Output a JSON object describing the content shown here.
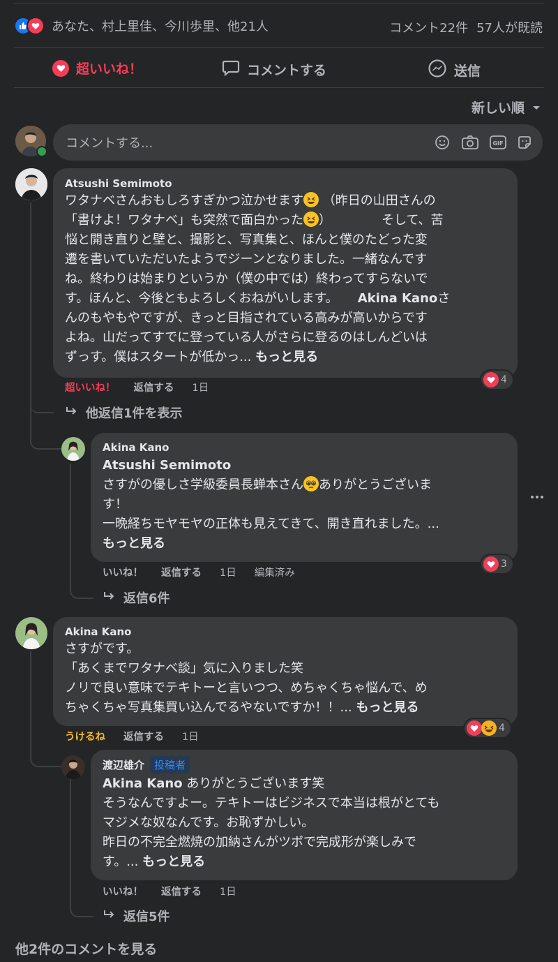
{
  "summary": {
    "reactors_text": "あなた、村上里佳、今川歩里、他21人",
    "comments_count": "コメント22件",
    "seen_count": "57人が既読"
  },
  "actions": {
    "love": "超いいね！",
    "comment": "コメントする",
    "send": "送信"
  },
  "sort": {
    "label": "新しい順"
  },
  "composer": {
    "placeholder": "コメントする..."
  },
  "comments": [
    {
      "author": "Atsushi Semimoto",
      "lines": [
        "ワタナベさんおもしろすぎかつ泣かせます",
        "（昨日の山田さんの",
        "「書けよ！ワタナベ」も突然で面白かった",
        "）",
        "そして、苦",
        "悩と開き直りと壁と、撮影と、写真集と、ほんと僕のたどった変",
        "遷を書いていただいたようでジーンとなりました。一緒なんです",
        "ね。終わりは始まりというか（僕の中では）終わってすらないで",
        "す。ほんと、今後ともよろしくおねがいします。",
        "Akina Kano",
        "さ",
        "んのもやもやですが、きっと目指されている高みが高いからです",
        "よね。山だってすでに登っている人がさらに登るのはしんどいは",
        "ずっす。僕はスタートが低かっ...",
        "もっと見る"
      ],
      "reaction_label": "超いいね！",
      "reply_label": "返信する",
      "time": "1日",
      "reaction_count": "4",
      "more_replies": "他返信1件を表示"
    },
    {
      "author": "Akina Kano",
      "mention": "Atsushi Semimoto",
      "lines": [
        "さすがの優しさ学級委員長蝉本さん",
        "ありがとうございま",
        "す！",
        "一晩経ちモヤモヤの正体も見えてきて、開き直れました。...",
        "もっと見る"
      ],
      "like_label": "いいね！",
      "reply_label": "返信する",
      "time": "1日",
      "edited": "編集済み",
      "reaction_count": "3",
      "replies": "返信6件"
    },
    {
      "author": "Akina Kano",
      "lines": [
        "さすがです。",
        "「あくまでワタナベ談」気に入りました笑",
        "ノリで良い意味でテキトーと言いつつ、めちゃくちゃ悩んで、め",
        "ちゃくちゃ写真集買い込んでるやないですか！！...",
        "もっと見る"
      ],
      "reaction_label": "うけるね",
      "reply_label": "返信する",
      "time": "1日",
      "reaction_count": "4"
    },
    {
      "author": "渡辺雄介",
      "badge": "投稿者",
      "mention": "Akina Kano",
      "lines": [
        "ありがとうございます笑",
        "そうなんですよー。テキトーはビジネスで本当は根がとても",
        "マジメな奴なんです。お恥ずかしい。",
        "昨日の不完全燃焼の加納さんがツボで完成形が楽しみで",
        "す。...",
        "もっと見る"
      ],
      "like_label": "いいね！",
      "reply_label": "返信する",
      "time": "1日",
      "replies": "返信5件"
    }
  ],
  "footer": {
    "more_comments": "他2件のコメントを見る"
  },
  "colors": {
    "love": "#f33e58",
    "like": "#1877f2",
    "haha": "#f7b125",
    "accent": "#2d88ff"
  }
}
